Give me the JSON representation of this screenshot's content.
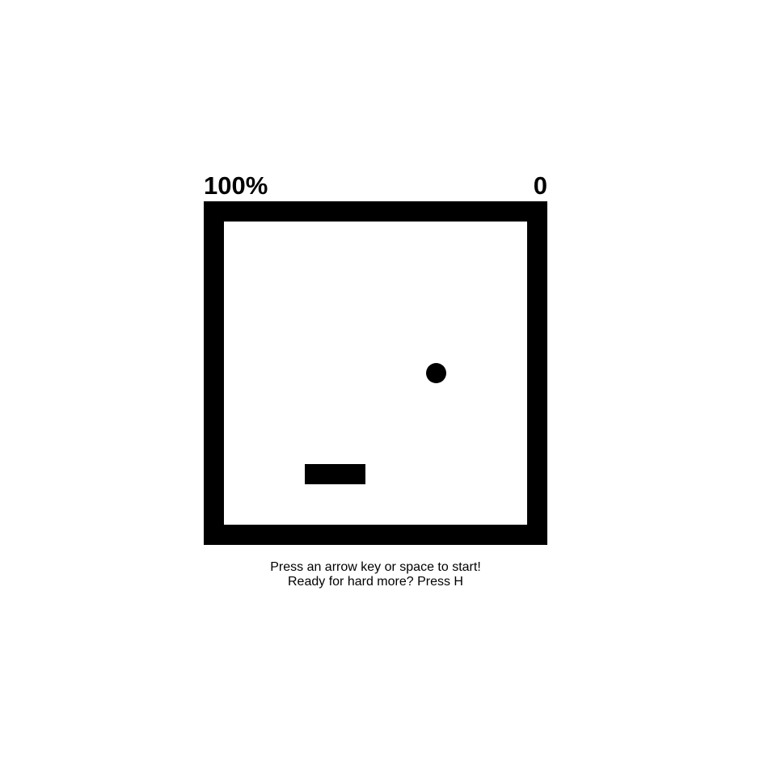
{
  "hud": {
    "percent": "100%",
    "score": "0"
  },
  "colors": {
    "background": "#ffffff",
    "foreground": "#000000"
  },
  "game": {
    "ball_shape": "circle",
    "paddle_shape": "rectangle"
  },
  "instructions": {
    "line1": "Press an arrow key or space to start!",
    "line2": "Ready for hard more? Press H"
  }
}
